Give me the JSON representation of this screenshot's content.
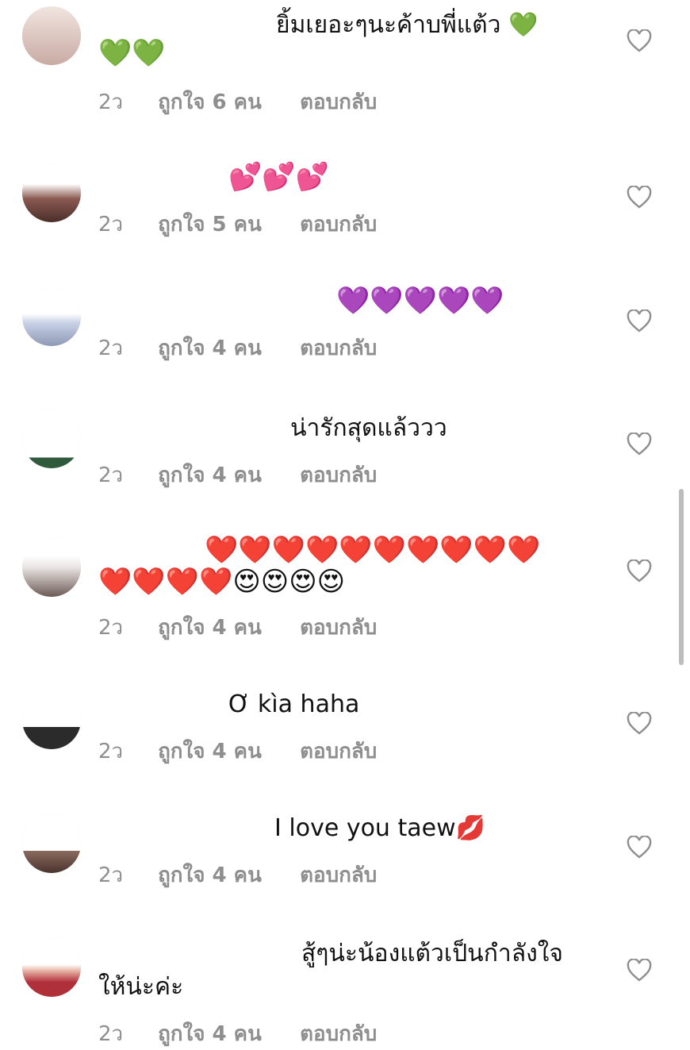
{
  "comments": [
    {
      "avatar_color": "#e8d6d0",
      "text_line1": "ยิ้มเยอะๆนะค้าบพี่แต้ว 💚",
      "text_line2": "💚💚",
      "time": "2ว",
      "likes": "ถูกใจ 6 คน",
      "reply": "ตอบกลับ"
    },
    {
      "avatar_color": "#7a4a3e",
      "text_line1": "💕💕💕",
      "time": "2ว",
      "likes": "ถูกใจ 5 คน",
      "reply": "ตอบกลับ"
    },
    {
      "avatar_color": "#cfd6e8",
      "text_line1": "💜💜💜💜💜",
      "time": "2ว",
      "likes": "ถูกใจ 4 คน",
      "reply": "ตอบกลับ"
    },
    {
      "avatar_color": "#2f5a3c",
      "text_line1": "น่ารักสุดแล้ววว",
      "time": "2ว",
      "likes": "ถูกใจ 4 คน",
      "reply": "ตอบกลับ"
    },
    {
      "avatar_color": "#6b5a55",
      "text_line1": "❤️❤️❤️❤️❤️❤️❤️❤️❤️❤️",
      "text_line2": "❤️❤️❤️❤️😍😍😍😍",
      "time": "2ว",
      "likes": "ถูกใจ 4 คน",
      "reply": "ตอบกลับ"
    },
    {
      "avatar_color": "#2b2b2b",
      "text_line1": "Ơ kìa haha",
      "time": "2ว",
      "likes": "ถูกใจ 4 คน",
      "reply": "ตอบกลับ"
    },
    {
      "avatar_color": "#5a4038",
      "text_line1": "I love you taew💋",
      "time": "2ว",
      "likes": "ถูกใจ 4 คน",
      "reply": "ตอบกลับ"
    },
    {
      "avatar_color": "#b0303a",
      "text_line1": "สู้ๆน่ะน้องแต้วเป็นกำลังใจ",
      "text_line2": "ให้น่ะค่ะ",
      "time": "2ว",
      "likes": "ถูกใจ 4 คน",
      "reply": "ตอบกลับ"
    }
  ],
  "icons": {
    "like": "heart-outline-icon"
  }
}
